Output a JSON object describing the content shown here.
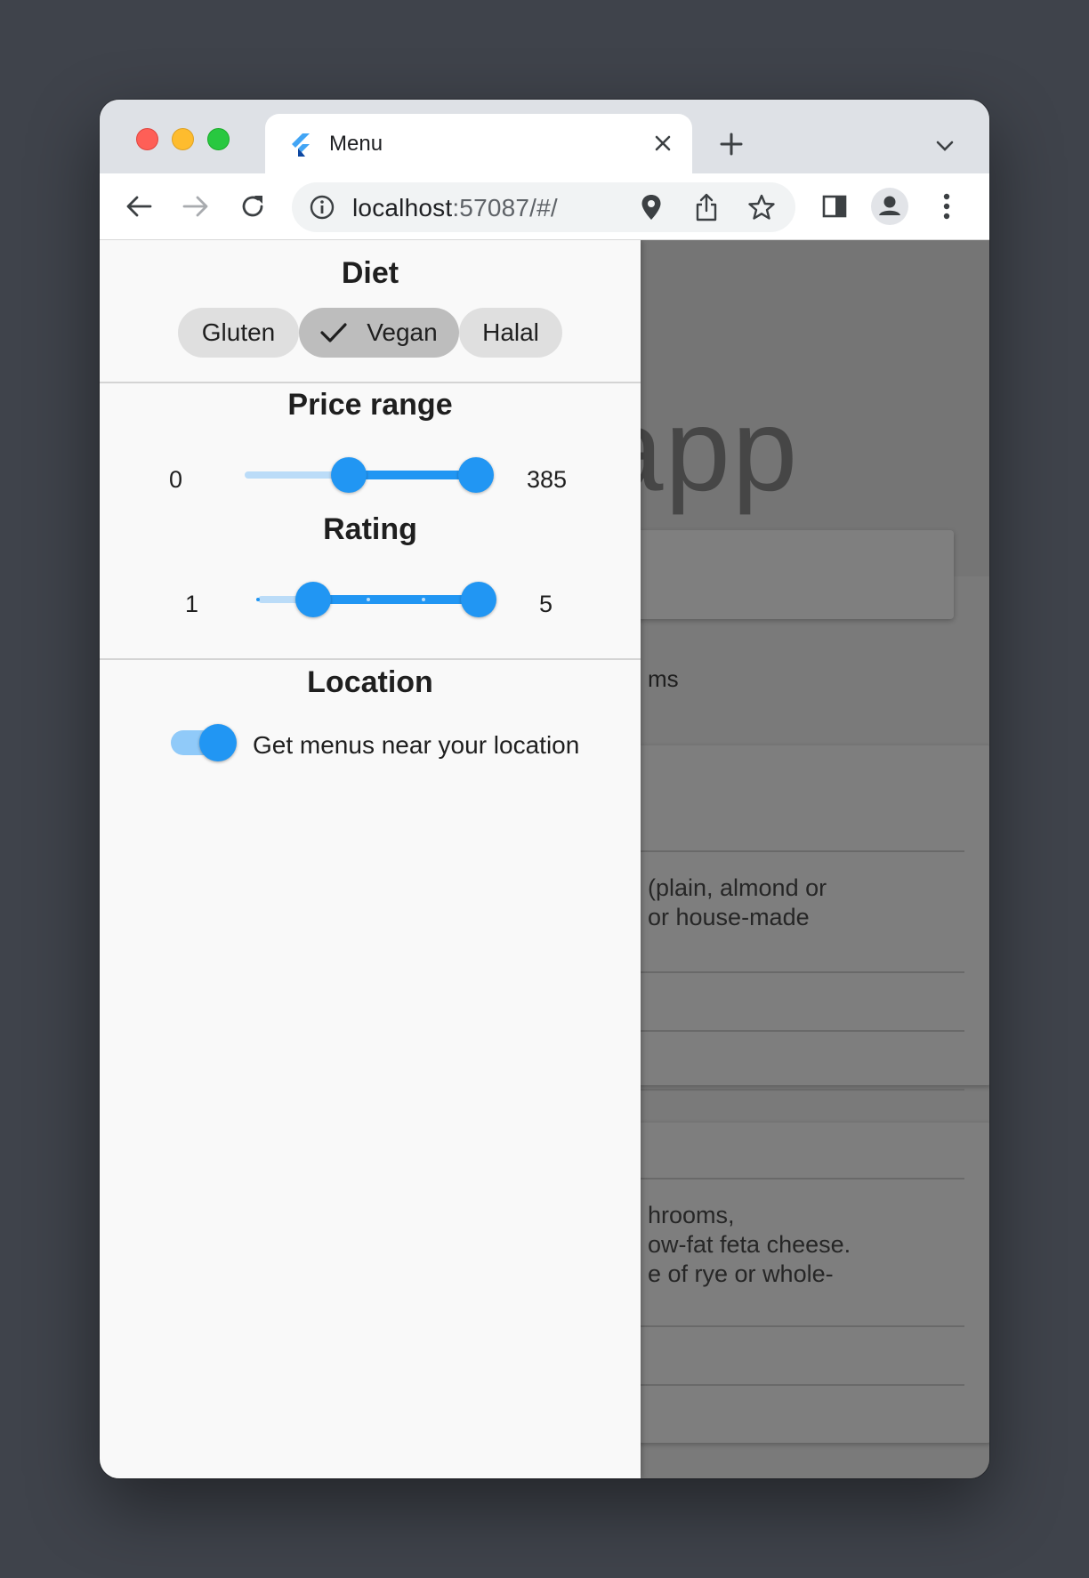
{
  "browser": {
    "tab_title": "Menu",
    "url_host": "localhost",
    "url_rest": ":57087/#/"
  },
  "background": {
    "app_title_fragment": "app",
    "items_label_fragment": "ms",
    "card1_lines": [
      "(plain, almond or",
      "or house-made"
    ],
    "card2_lines": [
      "hrooms,",
      "ow-fat feta cheese.",
      "e of rye or whole-"
    ]
  },
  "drawer": {
    "diet": {
      "title": "Diet",
      "chips": [
        {
          "label": "Gluten",
          "selected": false
        },
        {
          "label": "Vegan",
          "selected": true
        },
        {
          "label": "Halal",
          "selected": false
        }
      ]
    },
    "price": {
      "title": "Price range",
      "min_label": "0",
      "max_label": "385",
      "range_min": 0,
      "range_max": 385,
      "selected_start": 173,
      "selected_end": 385
    },
    "rating": {
      "title": "Rating",
      "min_label": "1",
      "max_label": "5",
      "range_min": 1,
      "range_max": 5,
      "selected_start": 2,
      "selected_end": 5
    },
    "location": {
      "title": "Location",
      "toggle_label": "Get menus near your location",
      "toggle_on": true
    }
  },
  "colors": {
    "accent": "#2196f3",
    "accent_light": "#bbdcf8"
  }
}
